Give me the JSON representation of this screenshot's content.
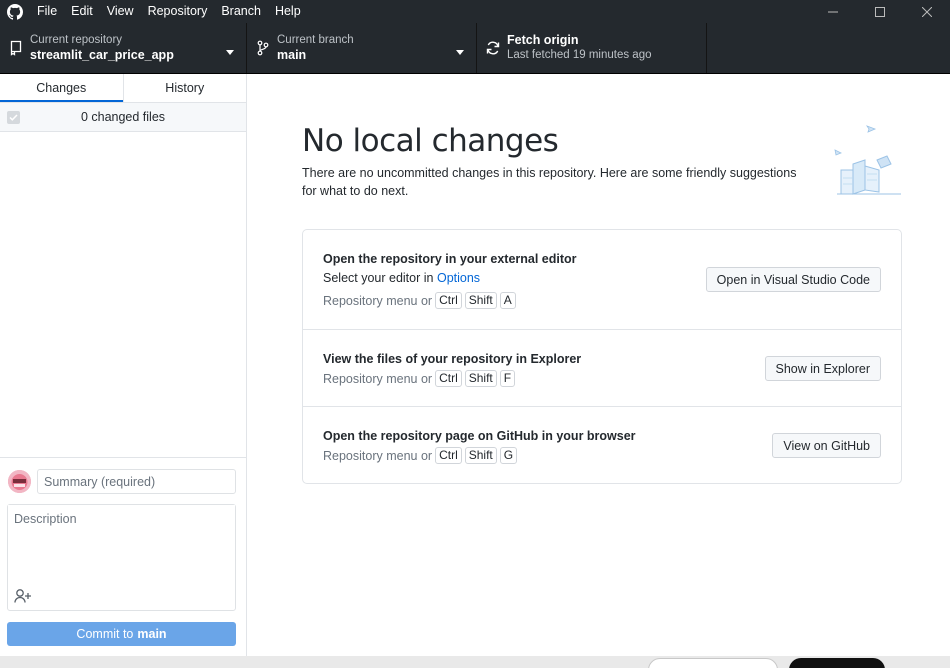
{
  "menu": [
    "File",
    "Edit",
    "View",
    "Repository",
    "Branch",
    "Help"
  ],
  "toolbar": {
    "repo_label": "Current repository",
    "repo_name": "streamlit_car_price_app",
    "branch_label": "Current branch",
    "branch_name": "main",
    "fetch_label": "Fetch origin",
    "fetch_status": "Last fetched 19 minutes ago"
  },
  "sidebar": {
    "tabs": [
      {
        "label": "Changes",
        "active": true
      },
      {
        "label": "History",
        "active": false
      }
    ],
    "changes_count": "0 changed files",
    "summary_placeholder": "Summary (required)",
    "description_placeholder": "Description",
    "commit_prefix": "Commit to",
    "commit_branch": "main"
  },
  "main": {
    "title": "No local changes",
    "description": "There are no uncommitted changes in this repository. Here are some friendly suggestions for what to do next.",
    "suggestions": [
      {
        "title": "Open the repository in your external editor",
        "line_prefix": "Select your editor in",
        "line_link": "Options",
        "menu_text": "Repository menu or",
        "keys": [
          "Ctrl",
          "Shift",
          "A"
        ],
        "button": "Open in Visual Studio Code"
      },
      {
        "title": "View the files of your repository in Explorer",
        "menu_text": "Repository menu or",
        "keys": [
          "Ctrl",
          "Shift",
          "F"
        ],
        "button": "Show in Explorer"
      },
      {
        "title": "Open the repository page on GitHub in your browser",
        "menu_text": "Repository menu or",
        "keys": [
          "Ctrl",
          "Shift",
          "G"
        ],
        "button": "View on GitHub"
      }
    ]
  },
  "icons": {
    "app": "github-logo-icon",
    "repo": "repo-icon",
    "branch": "git-branch-icon",
    "fetch": "sync-icon",
    "coauthor": "add-person-icon"
  },
  "colors": {
    "toolbar_bg": "#24292e",
    "accent": "#0366d6",
    "commit_button": "#6aa5e8"
  }
}
